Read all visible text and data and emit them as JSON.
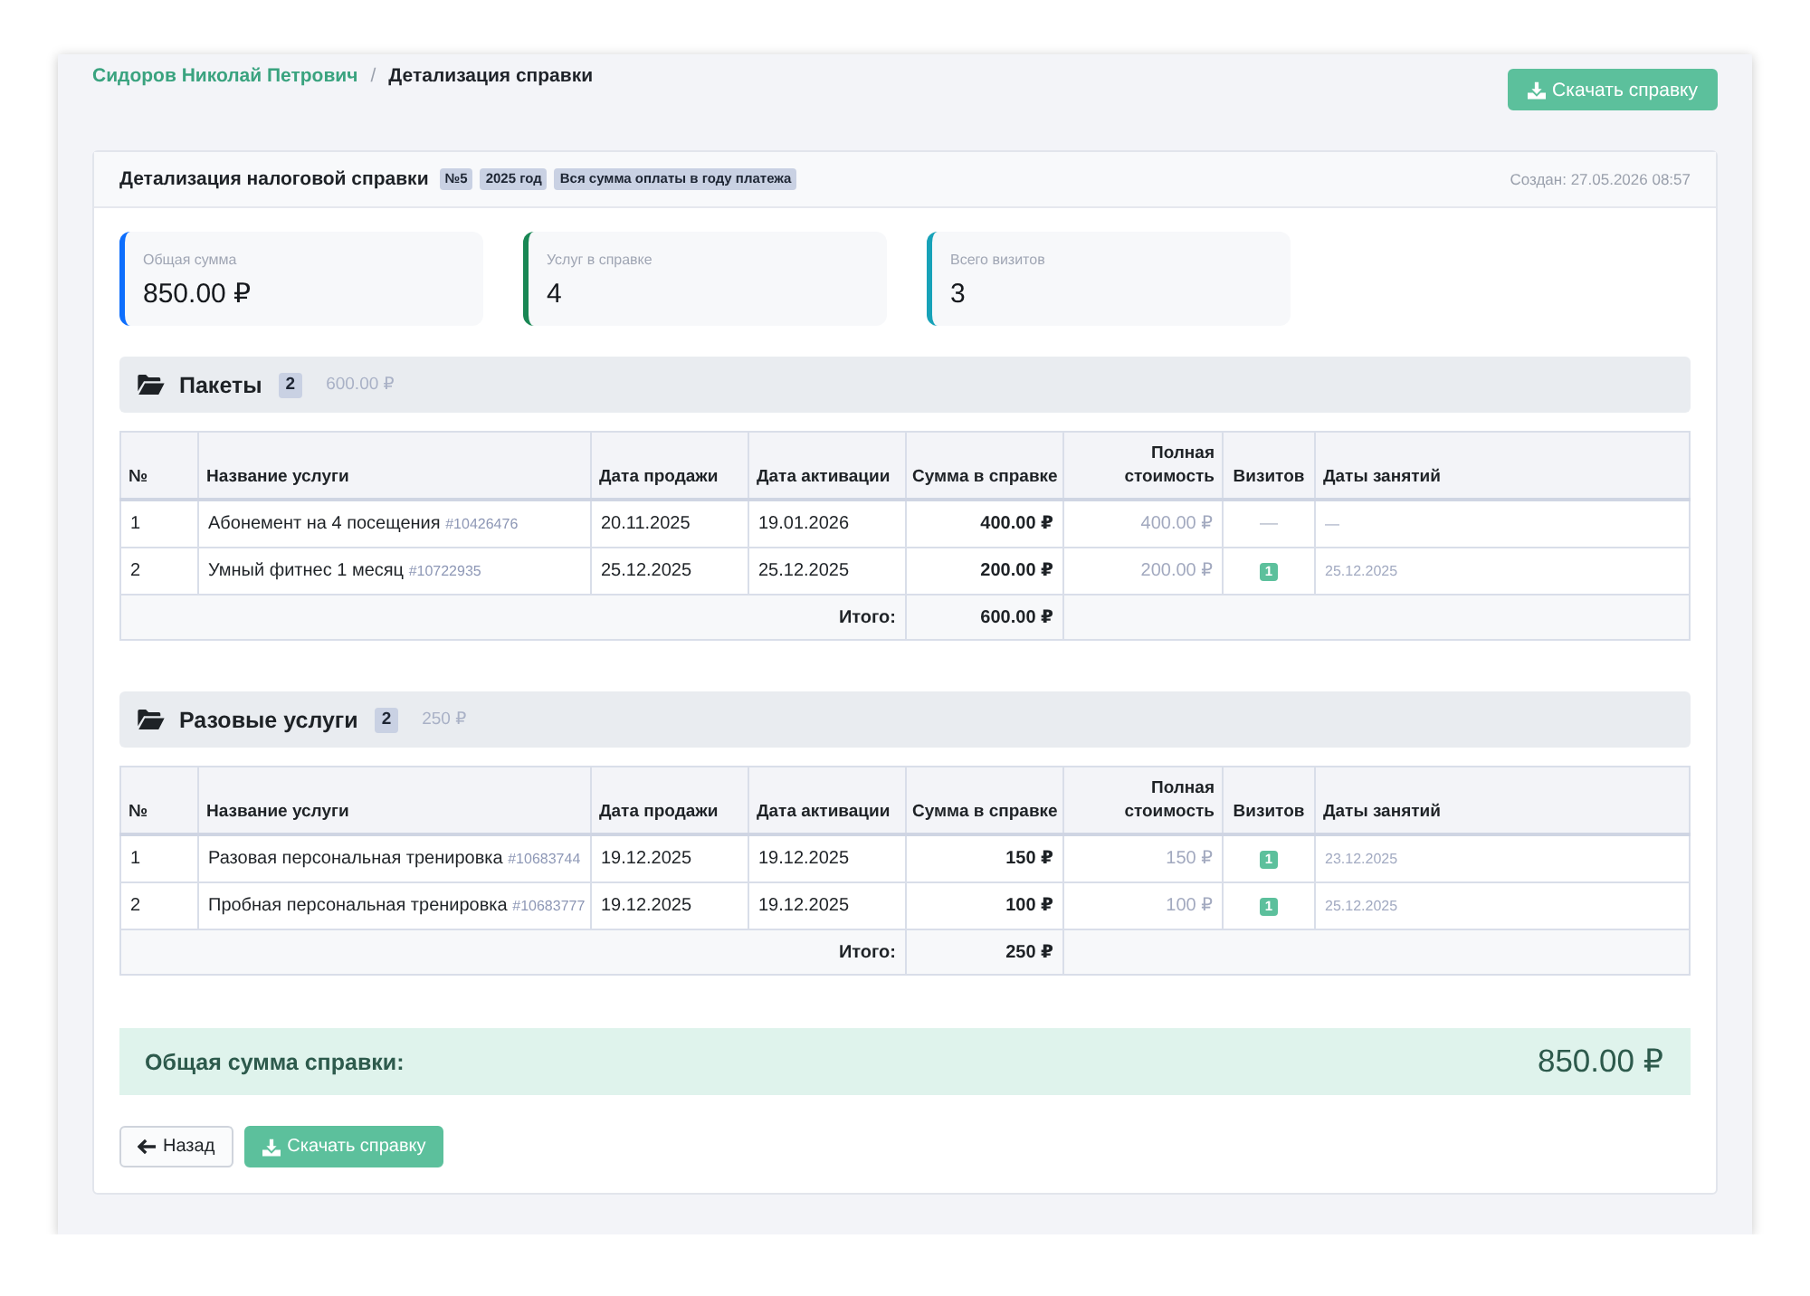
{
  "breadcrumb": {
    "items": [
      {
        "kind": "link",
        "label": "Сидоров Николай Петрович"
      },
      {
        "kind": "current",
        "label": "Детализация справки"
      }
    ],
    "separator": "/"
  },
  "header_buttons": [
    {
      "kind": "download",
      "label": "Скачать справку"
    }
  ],
  "report": {
    "title": "Детализация налоговой справки",
    "badges": [
      "№5",
      "2025 год",
      "Вся сумма оплаты в году платежа"
    ],
    "created": "Создан: 27.05.2026 08:57"
  },
  "stats": [
    {
      "label": "Общая сумма",
      "value": "850.00 ₽",
      "color": "#0d6efd"
    },
    {
      "label": "Услуг в справке",
      "value": "4",
      "color": "#198754"
    },
    {
      "label": "Всего визитов",
      "value": "3",
      "color": "#17a2b8"
    }
  ],
  "sections": [
    {
      "title": "Пакеты",
      "count": "2",
      "sum": "600.00 ₽",
      "columns": [
        "№",
        "Название услуги",
        "Дата продажи",
        "Дата активации",
        "Сумма в справке",
        "Полная стоимость",
        "Визитов",
        "Даты занятий"
      ],
      "rows": [
        {
          "number": "1",
          "name": "Абонемент на 4 посещения",
          "code": "#10426476",
          "sale_date": "20.11.2025",
          "activation_date": "19.01.2026",
          "amount": "400.00 ₽",
          "full_price": "400.00 ₽",
          "visits": {
            "kind": "dash",
            "text": "—"
          },
          "visit_dates": "—"
        },
        {
          "number": "2",
          "name": "Умный фитнес 1 месяц",
          "code": "#10722935",
          "sale_date": "25.12.2025",
          "activation_date": "25.12.2025",
          "amount": "200.00 ₽",
          "full_price": "200.00 ₽",
          "visits": {
            "kind": "badge",
            "text": "1"
          },
          "visit_dates": "25.12.2025"
        }
      ],
      "total": {
        "label": "Итого:",
        "value": "600.00 ₽"
      }
    },
    {
      "title": "Разовые услуги",
      "count": "2",
      "sum": "250 ₽",
      "columns": [
        "№",
        "Название услуги",
        "Дата продажи",
        "Дата активации",
        "Сумма в справке",
        "Полная стоимость",
        "Визитов",
        "Даты занятий"
      ],
      "rows": [
        {
          "number": "1",
          "name": "Разовая персональная тренировка",
          "code": "#10683744",
          "sale_date": "19.12.2025",
          "activation_date": "19.12.2025",
          "amount": "150 ₽",
          "full_price": "150 ₽",
          "visits": {
            "kind": "badge",
            "text": "1"
          },
          "visit_dates": "23.12.2025"
        },
        {
          "number": "2",
          "name": "Пробная персональная тренировка",
          "code": "#10683777",
          "sale_date": "19.12.2025",
          "activation_date": "19.12.2025",
          "amount": "100 ₽",
          "full_price": "100 ₽",
          "visits": {
            "kind": "badge",
            "text": "1"
          },
          "visit_dates": "25.12.2025"
        }
      ],
      "total": {
        "label": "Итого:",
        "value": "250 ₽"
      }
    }
  ],
  "grand_total": {
    "label": "Общая сумма справки:",
    "value": "850.00 ₽"
  },
  "footer_buttons": [
    {
      "kind": "back",
      "label": "Назад"
    },
    {
      "kind": "download",
      "label": "Скачать справку"
    }
  ]
}
